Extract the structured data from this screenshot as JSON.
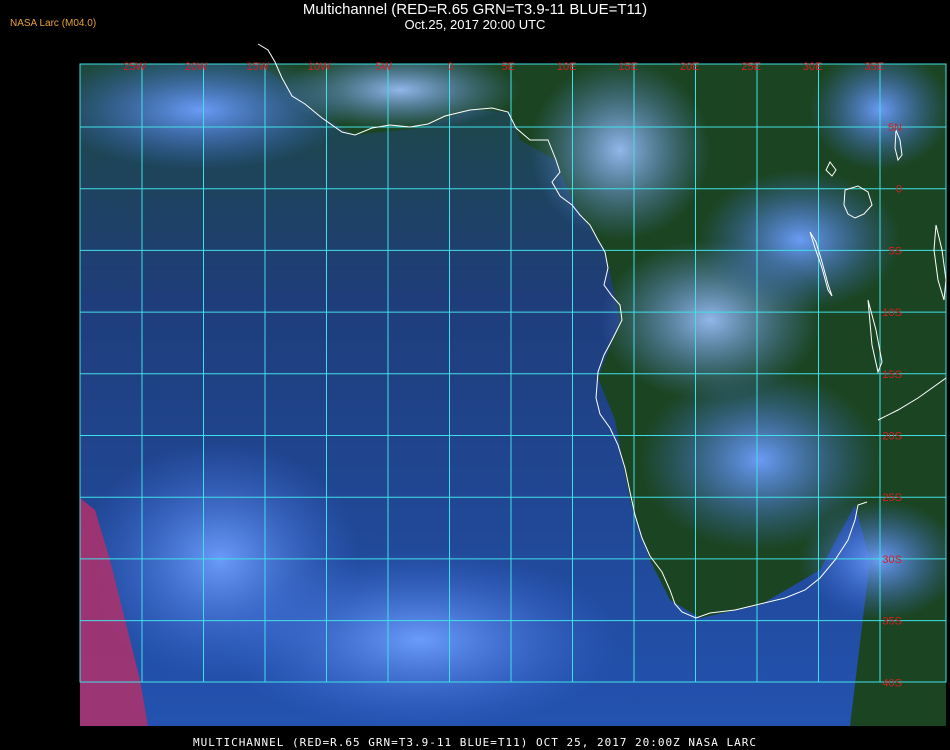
{
  "header": {
    "title": "Multichannel (RED=R.65 GRN=T3.9-11 BLUE=T11)",
    "subtitle": "Oct.25, 2017 20:00 UTC",
    "badge": "NASA Larc (M04.0)"
  },
  "footer": {
    "caption": "MULTICHANNEL (RED=R.65 GRN=T3.9-11 BLUE=T11) OCT 25, 2017 20:00Z  NASA LARC"
  },
  "map": {
    "grid_color": "#40e0e8",
    "label_color": "#d42020",
    "coast_color": "#ffffff",
    "ocean_color": "#1f3f8a",
    "land_color": "#1c4a24",
    "cloud_color": "#5a86ff",
    "longitude_labels": [
      "25W",
      "20W",
      "15W",
      "10W",
      "5W",
      "0",
      "5E",
      "10E",
      "15E",
      "20E",
      "25E",
      "30E",
      "35E"
    ],
    "latitude_labels": [
      "5N",
      "0",
      "5S",
      "10S",
      "15S",
      "20S",
      "25S",
      "30S",
      "35S",
      "40S"
    ]
  }
}
